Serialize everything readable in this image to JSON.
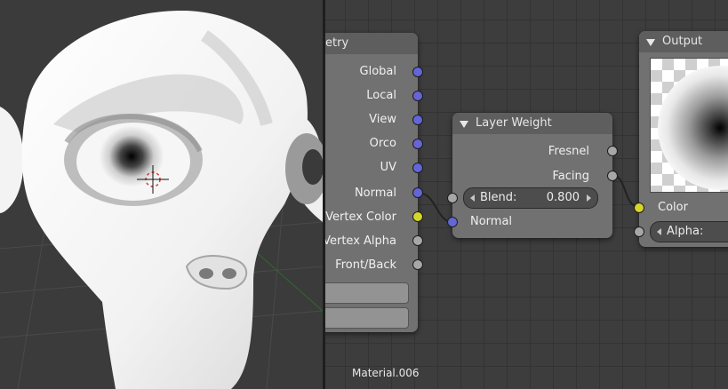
{
  "viewport": {
    "description_icon": "monkey-suzanne-mesh"
  },
  "geometry_node": {
    "title_partial": "etry",
    "outputs": [
      "Global",
      "Local",
      "View",
      "Orco",
      "UV",
      "Normal",
      "Vertex Color",
      "Vertex Alpha",
      "Front/Back"
    ]
  },
  "layer_weight_node": {
    "title": "Layer Weight",
    "outputs": [
      "Fresnel",
      "Facing"
    ],
    "blend_label": "Blend:",
    "blend_value": "0.800",
    "normal_input": "Normal"
  },
  "output_node": {
    "title": "Output",
    "color_input": "Color",
    "alpha_label": "Alpha:"
  },
  "material_name": "Material.006",
  "colors": {
    "vector_socket": "#6565d6",
    "color_socket": "#d6d62a",
    "float_socket": "#a7a7a7",
    "node_body": "#717171",
    "grid_bg": "#3d3d3d"
  }
}
